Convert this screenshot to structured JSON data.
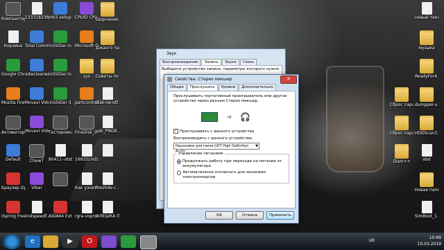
{
  "desktop": {
    "columns": [
      {
        "icons": [
          {
            "label": "Компьютер",
            "icon": "computer-icon",
            "style": "app6"
          },
          {
            "label": "Корзина",
            "icon": "recycle-bin-icon",
            "style": "file"
          },
          {
            "label": "Google Chrome",
            "icon": "chrome-icon",
            "style": "app3"
          },
          {
            "label": "Mozilla Firefox",
            "icon": "firefox-icon",
            "style": "app5"
          },
          {
            "label": "Активаторы",
            "icon": "activators-icon",
            "style": "app6"
          },
          {
            "label": "Default",
            "icon": "default-icon",
            "style": "app1"
          },
          {
            "label": "Браузер Opera",
            "icon": "opera-icon",
            "style": "app2"
          },
          {
            "label": "iSpring Free Cam 8",
            "icon": "ispring-icon",
            "style": "app2"
          }
        ]
      },
      {
        "icons": [
          {
            "label": "1333182369",
            "icon": "file-icon",
            "style": "file"
          },
          {
            "label": "Total Commander",
            "icon": "total-commander-icon",
            "style": "app1"
          },
          {
            "label": "adwcleaner...",
            "icon": "adwcleaner-icon",
            "style": "app1"
          },
          {
            "label": "Movavi Video...",
            "icon": "movavi-icon",
            "style": "app1"
          },
          {
            "label": "Movavi VideoEditor...",
            "icon": "movavi-editor-icon",
            "style": "app4"
          },
          {
            "label": "Chew7",
            "icon": "chew7-icon",
            "style": "app6"
          },
          {
            "label": "Viber",
            "icon": "viber-icon",
            "style": "app4"
          },
          {
            "label": "instspeedf...",
            "icon": "instspeed-icon",
            "style": "file"
          }
        ]
      },
      {
        "icons": [
          {
            "label": "mb3-setup-...",
            "icon": "malwarebytes-icon",
            "style": "app1"
          },
          {
            "label": "inSSIDer-in...",
            "icon": "inssider-icon",
            "style": "app3"
          },
          {
            "label": "inSSIDer-in...",
            "icon": "inssider-icon-2",
            "style": "app3"
          },
          {
            "label": "inSSIDer 3",
            "icon": "inssider3-icon",
            "style": "app3"
          },
          {
            "label": "Тестировка онлайн +...",
            "icon": "test-icon",
            "style": "app6"
          },
          {
            "label": "80411--stst...",
            "icon": "file-icon-2",
            "style": "file"
          },
          {
            "label": "",
            "icon": "black-icon",
            "style": "app6"
          },
          {
            "label": "AIDA64 Extreme",
            "icon": "aida64-icon",
            "style": "app2"
          }
        ]
      },
      {
        "icons": [
          {
            "label": "CPUID CPU-Z",
            "icon": "cpuz-icon",
            "style": "app4"
          },
          {
            "label": "Microsoft Office 20...",
            "icon": "office-icon",
            "style": "app5"
          },
          {
            "label": "sys",
            "icon": "folder-icon",
            "style": "folder"
          },
          {
            "label": "parkcontrol...",
            "icon": "parkcontrol-icon",
            "style": "app5"
          },
          {
            "label": "FineDisk_inst... v3.2.8",
            "icon": "finedisk-icon",
            "style": "app6"
          },
          {
            "label": "16932LmD...",
            "icon": "file-icon-3",
            "style": "file"
          },
          {
            "label": "Как узнать разрядно...",
            "icon": "doc-icon",
            "style": "file"
          },
          {
            "label": "rgra-vopro...",
            "icon": "file-icon-4",
            "style": "file"
          }
        ]
      },
      {
        "icons": [
          {
            "label": "Щорчиние система",
            "icon": "folder-icon-2",
            "style": "folder"
          },
          {
            "label": "Джанго папка",
            "icon": "folder-icon-3",
            "style": "folder"
          },
          {
            "label": "Советы по переходу...",
            "icon": "folder-icon-4",
            "style": "folder"
          },
          {
            "label": "disk-ne-otf...",
            "icon": "file-icon-5",
            "style": "file"
          },
          {
            "label": "usb_PNG8...",
            "icon": "file-icon-6",
            "style": "file"
          },
          {
            "label": "",
            "icon": "blank-icon",
            "style": "file"
          },
          {
            "label": "Prezhde-c...",
            "icon": "file-icon-7",
            "style": "file"
          },
          {
            "label": "ФЛЕШКА ПРОСИТ...",
            "icon": "flash-icon",
            "style": "file"
          }
        ]
      }
    ],
    "right_icons": [
      {
        "label": "новый текстовый ...",
        "icon": "text-file-icon",
        "style": "file"
      },
      {
        "label": "музыка",
        "icon": "music-folder-icon",
        "style": "folder"
      },
      {
        "label": "ReadyFor4...",
        "icon": "readyfor-icon",
        "style": "folder"
      },
      {
        "label": "dumpper-v...",
        "icon": "dumpper-icon",
        "style": "folder"
      },
      {
        "label": "HDDScan3.3",
        "icon": "hddscan-icon",
        "style": "folder"
      },
      {
        "label": "obd",
        "icon": "obd-icon",
        "style": "file"
      },
      {
        "label": "Новая папка (2)",
        "icon": "new-folder-icon",
        "style": "folder"
      },
      {
        "label": "SimBoot_1.8",
        "icon": "simboot-icon",
        "style": "file"
      }
    ],
    "mid_right_icons": [
      {
        "label": "Сброс параметр...",
        "icon": "reset-icon-1",
        "style": "folder"
      },
      {
        "label": "Сброс параметр...",
        "icon": "reset-icon-2",
        "style": "folder"
      },
      {
        "label": "Dism++",
        "icon": "dism-icon",
        "style": "folder"
      }
    ]
  },
  "back_window": {
    "title": "Звук",
    "tabs": [
      "Воспроизведение",
      "Запись",
      "Звуки",
      "Связь"
    ],
    "text": "Выберите устройство записи, параметры которого нужно"
  },
  "dialog": {
    "title": "Свойства: Стерео микшер",
    "close_label": "✕",
    "tabs": [
      "Общие",
      "Прослушать",
      "Уровни",
      "Дополнительно"
    ],
    "description": "Прослушивать портативный проигрыватель или другое устройство через разъем Стерео микшер.",
    "listen_checkbox": "Прослушивать с данного устройства",
    "playback_label": "Воспроизводить с данного устройства:",
    "playback_device": "Наушники для связи (IDT High Definition Audio",
    "power_group": "Управление питанием",
    "power_opt1": "Продолжать работу при переходе на питание от аккумулятора",
    "power_opt2": "Автоматически отключать для экономии электроэнергии",
    "ok": "OK",
    "cancel": "Отмена",
    "apply": "Применить"
  },
  "taskbar": {
    "lang": "UK",
    "time": "10:49",
    "date": "10.03.2019"
  }
}
